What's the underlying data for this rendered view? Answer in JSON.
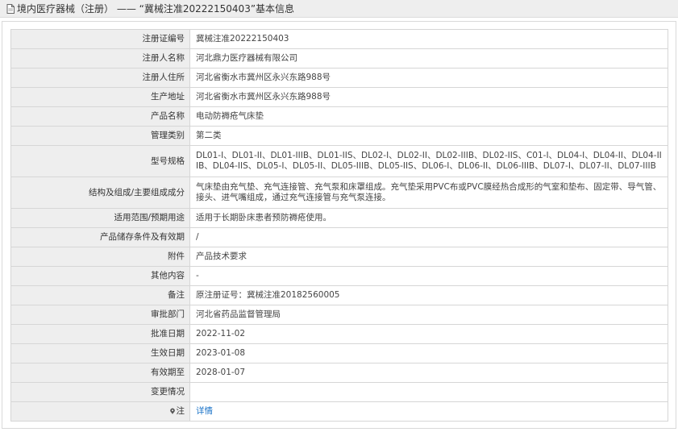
{
  "header": {
    "title": "境内医疗器械（注册） —— “冀械注准20222150403”基本信息"
  },
  "rows": [
    {
      "label": "注册证编号",
      "value": "冀械注准20222150403"
    },
    {
      "label": "注册人名称",
      "value": "河北鼎力医疗器械有限公司"
    },
    {
      "label": "注册人住所",
      "value": "河北省衡水市冀州区永兴东路988号"
    },
    {
      "label": "生产地址",
      "value": "河北省衡水市冀州区永兴东路988号"
    },
    {
      "label": "产品名称",
      "value": "电动防褥疮气床垫"
    },
    {
      "label": "管理类别",
      "value": "第二类"
    },
    {
      "label": "型号规格",
      "value": "DL01-I、DL01-II、DL01-IIIB、DL01-IIS、DL02-I、DL02-II、DL02-IIIB、DL02-IIS、C01-I、DL04-I、DL04-II、DL04-IIIB、DL04-IIS、DL05-I、DL05-II、DL05-IIIB、DL05-IIS、DL06-I、DL06-II、DL06-IIIB、DL07-I、DL07-II、DL07-IIIB"
    },
    {
      "label": "结构及组成/主要组成成分",
      "value": "气床垫由充气垫、充气连接管、充气泵和床罩组成。充气垫采用PVC布或PVC膜经热合成形的气室和垫布、固定带、导气管、接头、进气嘴组成，通过充气连接管与充气泵连接。"
    },
    {
      "label": "适用范围/预期用途",
      "value": "适用于长期卧床患者预防褥疮使用。"
    },
    {
      "label": "产品储存条件及有效期",
      "value": "/"
    },
    {
      "label": "附件",
      "value": "产品技术要求"
    },
    {
      "label": "其他内容",
      "value": "-"
    },
    {
      "label": "备注",
      "value": "原注册证号：冀械注准20182560005"
    },
    {
      "label": "审批部门",
      "value": "河北省药品监督管理局"
    },
    {
      "label": "批准日期",
      "value": "2022-11-02"
    },
    {
      "label": "生效日期",
      "value": "2023-01-08"
    },
    {
      "label": "有效期至",
      "value": "2028-01-07"
    },
    {
      "label": "变更情况",
      "value": ""
    }
  ],
  "note": {
    "label": "注",
    "icon": "pin-icon",
    "link_text": "详情",
    "link_color": "#1a73c8"
  }
}
